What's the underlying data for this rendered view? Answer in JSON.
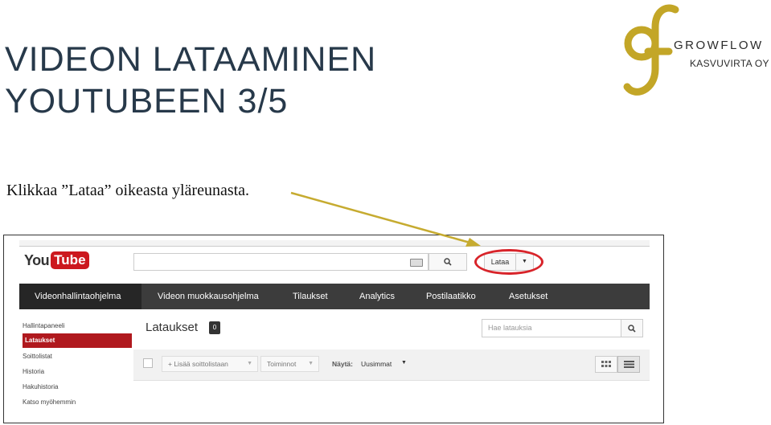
{
  "slide": {
    "title_line1": "VIDEON LATAAMINEN",
    "title_line2": "YOUTUBEEN 3/5",
    "instruction": "Klikkaa ”Lataa” oikeasta yläreunasta."
  },
  "logo": {
    "name": "GROWFLOW",
    "subtitle": "KASVUVIRTA OY",
    "color": "#c3a627"
  },
  "arrow_color": "#c6ab30",
  "highlight_color": "#d8242a",
  "youtube": {
    "logo_you": "You",
    "logo_tube": "Tube",
    "search_icon": "search-icon",
    "keyboard_icon": "keyboard-icon",
    "upload_label": "Lataa",
    "upload_dropdown_icon": "caret-down-icon",
    "nav": [
      {
        "label": "Videonhallintaohjelma",
        "active": true
      },
      {
        "label": "Videon muokkausohjelma",
        "active": false
      },
      {
        "label": "Tilaukset",
        "active": false
      },
      {
        "label": "Analytics",
        "active": false
      },
      {
        "label": "Postilaatikko",
        "active": false
      },
      {
        "label": "Asetukset",
        "active": false
      }
    ],
    "sidebar": [
      {
        "label": "Hallintapaneeli",
        "active": false
      },
      {
        "label": "Lataukset",
        "active": true
      },
      {
        "label": "Soittolistat",
        "active": false
      },
      {
        "label": "Historia",
        "active": false
      },
      {
        "label": "Hakuhistoria",
        "active": false
      },
      {
        "label": "Katso myöhemmin",
        "active": false
      }
    ],
    "uploads": {
      "heading": "Lataukset",
      "count": "0",
      "search_placeholder": "Hae latauksia",
      "add_to_playlist": "+ Lisää soittolistaan",
      "actions": "Toiminnot",
      "show_label": "Näytä:",
      "sort_value": "Uusimmat",
      "view_grid_icon": "grid-view-icon",
      "view_list_icon": "list-view-icon"
    }
  }
}
